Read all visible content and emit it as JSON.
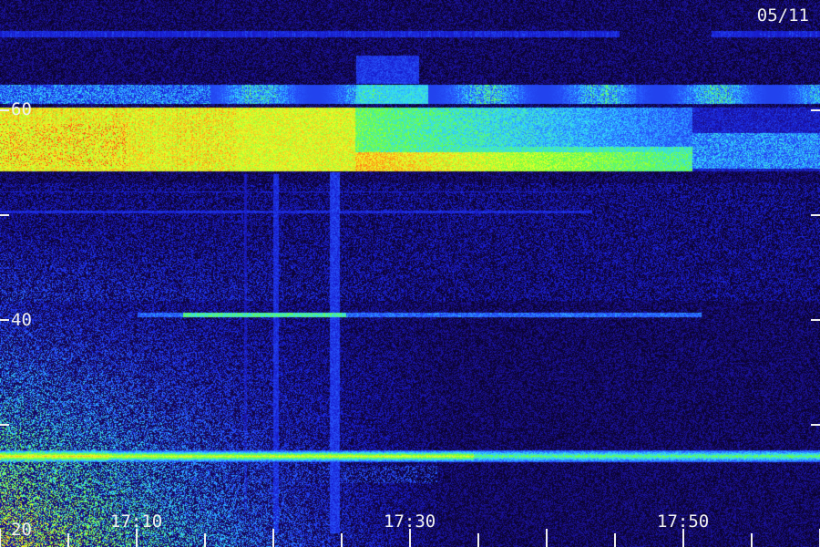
{
  "date_label": "05/11",
  "y_labels": [
    {
      "text": "60",
      "value": 60
    },
    {
      "text": "40",
      "value": 40
    },
    {
      "text": "20",
      "value": 20
    }
  ],
  "x_labels": [
    {
      "text": "17:10",
      "minute": 10
    },
    {
      "text": "17:30",
      "minute": 30
    },
    {
      "text": "17:50",
      "minute": 50
    }
  ],
  "colors": {
    "background": "#05021a",
    "low": "#1a0e8a",
    "mid": "#1f3dff",
    "cyan": "#33e6ff",
    "green": "#6cff3a",
    "yellow": "#ffff33",
    "red": "#ff2a1a",
    "axis": "#f0f0f0"
  }
}
